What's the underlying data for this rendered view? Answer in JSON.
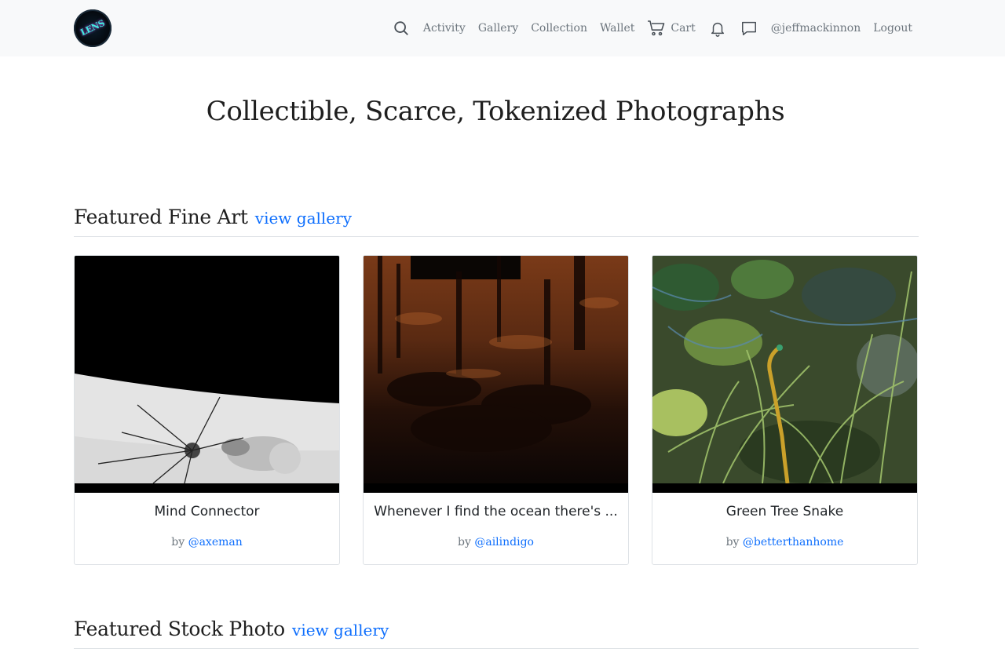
{
  "nav": {
    "logo_text": "LENS",
    "items": {
      "activity": "Activity",
      "gallery": "Gallery",
      "collection": "Collection",
      "wallet": "Wallet",
      "cart": "Cart",
      "user": "@jeffmackinnon",
      "logout": "Logout"
    },
    "icons": [
      "search-icon",
      "cart-icon",
      "bell-icon",
      "message-icon"
    ]
  },
  "hero": {
    "title": "Collectible, Scarce, Tokenized Photographs"
  },
  "sections": [
    {
      "heading": "Featured Fine Art",
      "link": "view gallery",
      "cards": [
        {
          "title": "Mind Connector",
          "by_prefix": "by",
          "author": "@axeman"
        },
        {
          "title": "Whenever I find the ocean there's ...",
          "by_prefix": "by",
          "author": "@ailindigo"
        },
        {
          "title": "Green Tree Snake",
          "by_prefix": "by",
          "author": "@betterthanhome"
        }
      ]
    },
    {
      "heading": "Featured Stock Photo",
      "link": "view gallery"
    }
  ],
  "colors": {
    "link": "#0d6efd",
    "navbar_bg": "#f8f9fa",
    "muted": "#6c757d"
  }
}
